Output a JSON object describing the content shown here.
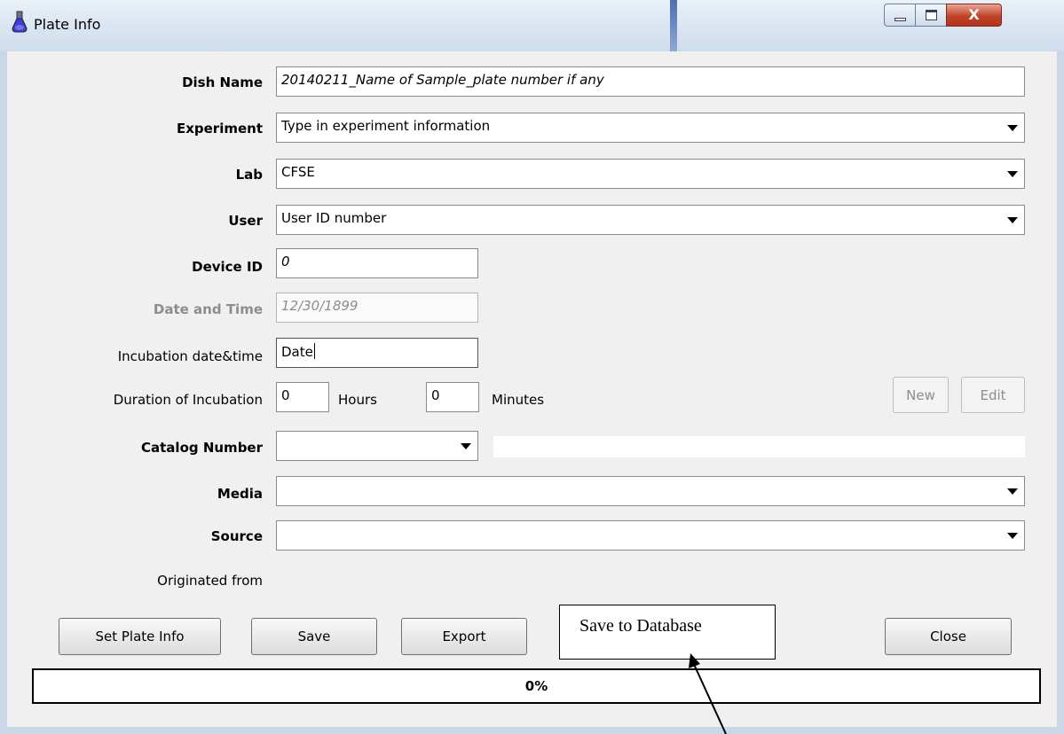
{
  "window": {
    "title": "Plate Info",
    "controls": {
      "close_glyph": "X"
    }
  },
  "form": {
    "dish_name": {
      "label": "Dish Name",
      "value": "20140211_Name of Sample_plate number if any"
    },
    "experiment": {
      "label": "Experiment",
      "value": "Type in experiment information"
    },
    "lab": {
      "label": "Lab",
      "value": "CFSE"
    },
    "user": {
      "label": "User",
      "value": "User ID number"
    },
    "device_id": {
      "label": "Device ID",
      "value": "0"
    },
    "date_time": {
      "label": "Date and Time",
      "value": "12/30/1899"
    },
    "incubation_datetime": {
      "label": "Incubation date&time",
      "value": "Date"
    },
    "duration": {
      "label": "Duration of Incubation",
      "hours_value": "0",
      "hours_label": "Hours",
      "minutes_value": "0",
      "minutes_label": "Minutes"
    },
    "catalog_number": {
      "label": "Catalog Number",
      "value": ""
    },
    "media": {
      "label": "Media",
      "value": ""
    },
    "source": {
      "label": "Source",
      "value": ""
    },
    "originated_from": {
      "label": "Originated from"
    }
  },
  "buttons": {
    "new": "New",
    "edit": "Edit",
    "set_plate_info": "Set Plate Info",
    "save": "Save",
    "export": "Export",
    "close": "Close"
  },
  "progress": {
    "text": "0%",
    "value": 0
  },
  "annotation": {
    "callout_text": "Save to Database"
  },
  "colors": {
    "window_bg": "#f0f0f0",
    "title_gradient_top": "#e9f0f8",
    "close_button": "#c0442a",
    "disabled_text": "#8d8d8d"
  }
}
